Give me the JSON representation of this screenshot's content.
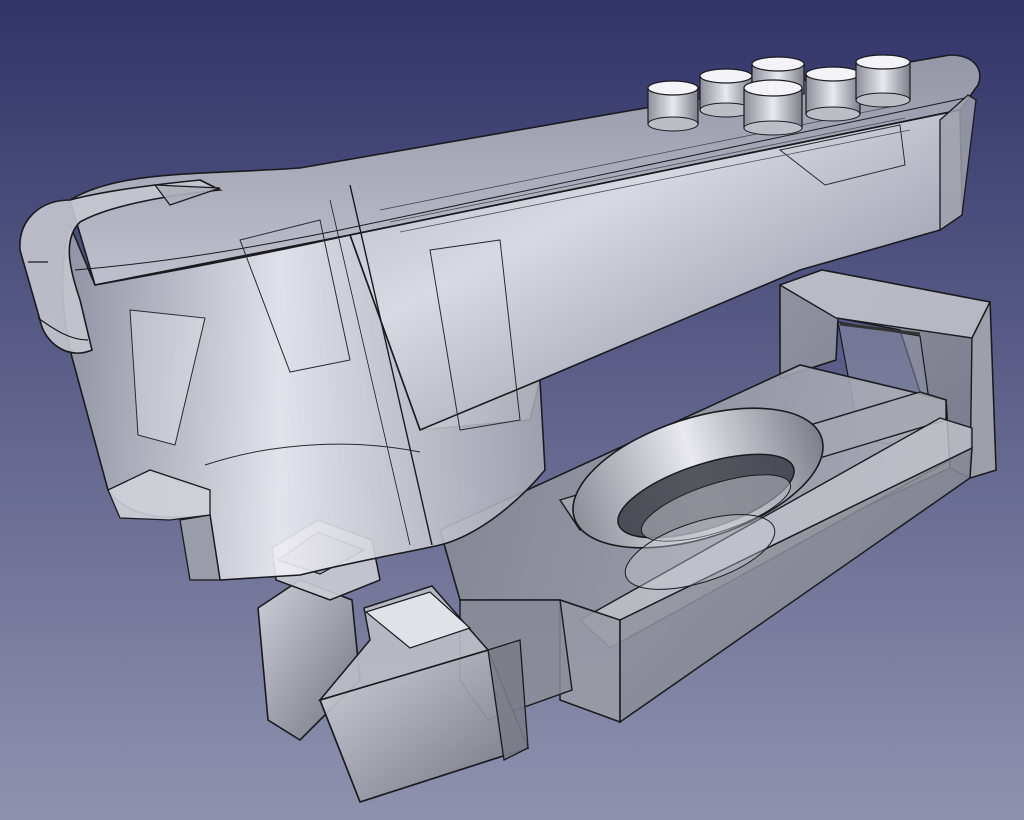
{
  "viewport": {
    "background_top": "#323469",
    "background_bottom": "#8f92ae",
    "render_mode": "transparent-shaded-with-edges"
  },
  "model": {
    "face_color": "#b9bac2",
    "edge_color": "#1a1a1f",
    "highlight_color": "#f2f2f6",
    "shadow_color": "#6c6d78",
    "parts": [
      "main-housing",
      "base-bracket",
      "clip-mechanism"
    ]
  }
}
